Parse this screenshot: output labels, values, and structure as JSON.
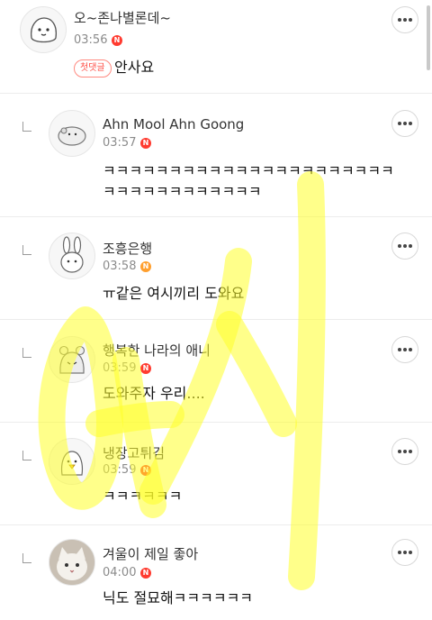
{
  "comments": [
    {
      "author": "오~존나별론데~",
      "time": "03:56",
      "badge": "N",
      "badge_color": "#ff3b30",
      "first_comment_label": "첫댓글",
      "text": "안사요"
    },
    {
      "author": "Ahn Mool Ahn Goong",
      "time": "03:57",
      "badge": "N",
      "badge_color": "#ff3b30",
      "text_lines": [
        "ㅋㅋㅋㅋㅋㅋㅋㅋㅋㅋㅋㅋㅋㅋㅋㅋㅋㅋㅋㅋㅋㅋ",
        "ㅋㅋㅋㅋㅋㅋㅋㅋㅋㅋㅋㅋ"
      ]
    },
    {
      "author": "조흥은행",
      "time": "03:58",
      "badge": "N",
      "badge_color": "#ff9f2e",
      "text": "ㅠ같은 여시끼리 도와요"
    },
    {
      "author": "행복한 나라의 애니",
      "time": "03:59",
      "badge": "N",
      "badge_color": "#ff3b30",
      "text": "도와주자 우리...."
    },
    {
      "author": "냉장고튀김",
      "time": "03:59",
      "badge": "N",
      "badge_color": "#ff3b30",
      "text": "ㅋㅋㅋㅋㅋㅋ"
    },
    {
      "author": "겨울이 제일 좋아",
      "time": "04:00",
      "badge": "N",
      "badge_color": "#ff3b30",
      "text": "닉도 절묘해ㅋㅋㅋㅋㅋㅋ"
    }
  ],
  "icons": {
    "more": "more-horizontal-icon",
    "reply": "reply-indent-icon"
  },
  "watermark_color": "#ffff2a"
}
